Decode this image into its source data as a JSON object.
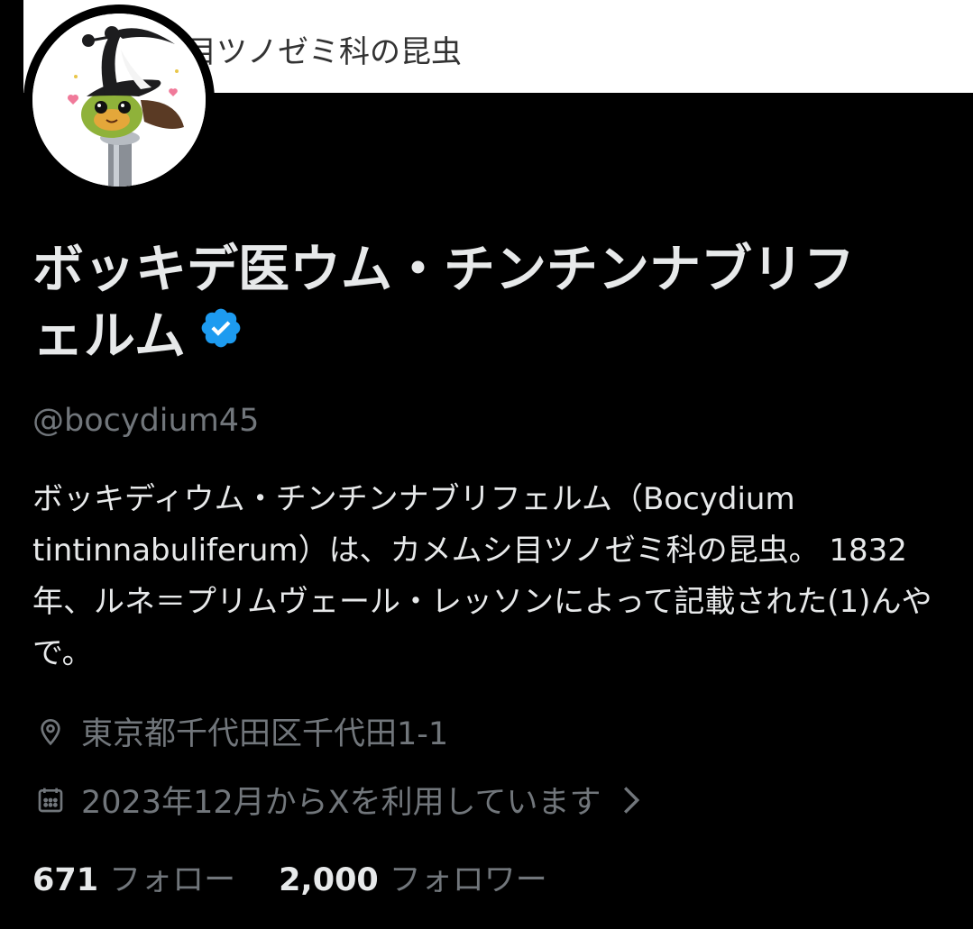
{
  "banner": {
    "text": "目ツノゼミ科の昆虫"
  },
  "profile": {
    "display_name": "ボッキデ医ウム・チンチンナブリフェルム",
    "verified_icon": "verified-badge-icon",
    "handle": "@bocydium45",
    "bio": "ボッキディウム・チンチンナブリフェルム（Bocydium tintinnabuliferum）は、カメムシ目ツノゼミ科の昆虫。 1832年、ルネ＝プリムヴェール・レッソンによって記載された(1)んやで。",
    "location": "東京都千代田区千代田1-1",
    "joined": "2023年12月からXを利用しています",
    "following_count": "671",
    "following_label": "フォロー",
    "followers_count": "2,000",
    "followers_label": "フォロワー"
  },
  "colors": {
    "background": "#000000",
    "text_primary": "#e7e9ea",
    "text_secondary": "#71767b",
    "verified_blue": "#1d9bf0"
  }
}
